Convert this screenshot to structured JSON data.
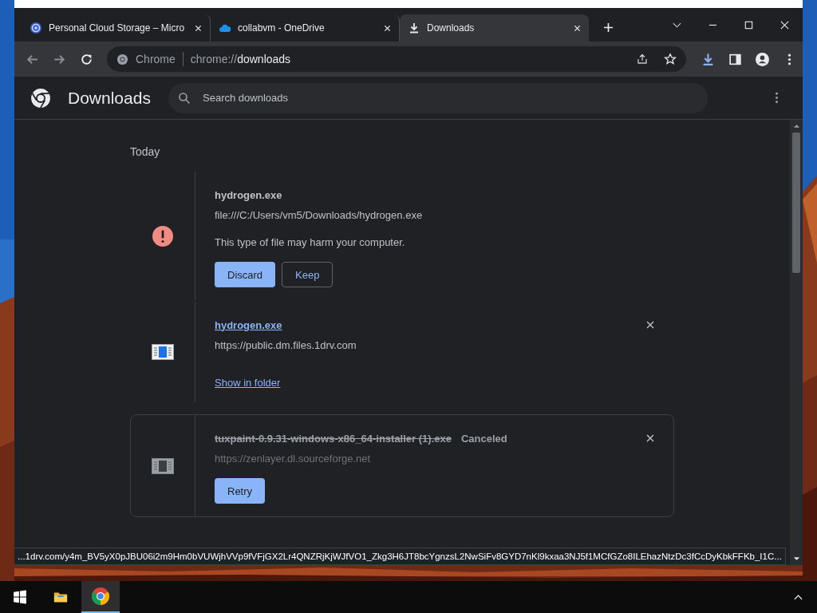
{
  "tabs": [
    {
      "title": "Personal Cloud Storage – Micro",
      "selected": false
    },
    {
      "title": "collabvm - OneDrive",
      "selected": false
    },
    {
      "title": "Downloads",
      "selected": true
    }
  ],
  "toolbar": {
    "site_label": "Chrome",
    "url_scheme": "chrome://",
    "url_host": "downloads"
  },
  "page": {
    "title": "Downloads",
    "search": {
      "placeholder": "Search downloads"
    }
  },
  "section": "Today",
  "downloads": [
    {
      "kind": "dangerous",
      "name": "hydrogen.exe",
      "url": "file:///C:/Users/vm5/Downloads/hydrogen.exe",
      "warning": "This type of file may harm your computer.",
      "buttons": [
        {
          "label": "Discard",
          "primary": true
        },
        {
          "label": "Keep",
          "primary": false
        }
      ],
      "highlighted": false
    },
    {
      "kind": "complete",
      "name": "hydrogen.exe",
      "url": "https://public.dm.files.1drv.com",
      "link": "Show in folder",
      "highlighted": false
    },
    {
      "kind": "canceled",
      "name": "tuxpaint-0.9.31-windows-x86_64-installer (1).exe",
      "status": "Canceled",
      "url": "https://zenlayer.dl.sourceforge.net",
      "buttons": [
        {
          "label": "Retry",
          "primary": true
        }
      ],
      "highlighted": true
    }
  ],
  "status_bar": "...1drv.com/y4m_BV5yX0pJBU06i2m9Hm0bVUWjhVVp9fVFjGX2Lr4QNZRjKjWJfVO1_Zkg3H6JT8bcYgnzsL2NwSiFv8GYD7nKl9kxaa3NJ5f1MCfGZo8ILEhazNtzDc3fCcDyKbkFFKb_I1C..."
}
